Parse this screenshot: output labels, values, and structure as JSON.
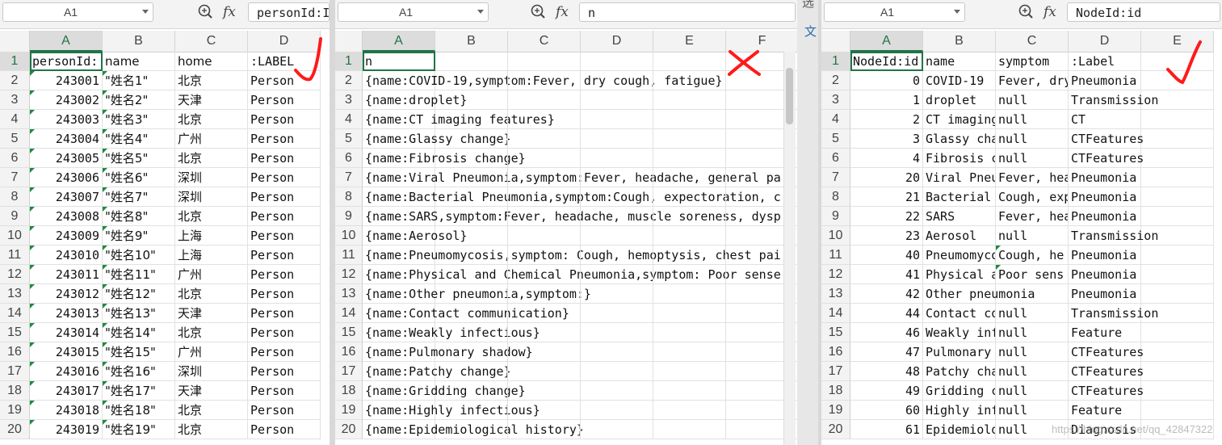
{
  "panes": [
    {
      "namebox": "A1",
      "formula": "personId:I",
      "columns": [
        "A",
        "B",
        "C",
        "D"
      ],
      "rows": [
        [
          "1",
          "personId:",
          "name",
          "home",
          ":LABEL"
        ],
        [
          "2",
          "243001",
          "\"姓名1\"",
          "北京",
          "Person"
        ],
        [
          "3",
          "243002",
          "\"姓名2\"",
          "天津",
          "Person"
        ],
        [
          "4",
          "243003",
          "\"姓名3\"",
          "北京",
          "Person"
        ],
        [
          "5",
          "243004",
          "\"姓名4\"",
          "广州",
          "Person"
        ],
        [
          "6",
          "243005",
          "\"姓名5\"",
          "北京",
          "Person"
        ],
        [
          "7",
          "243006",
          "\"姓名6\"",
          "深圳",
          "Person"
        ],
        [
          "8",
          "243007",
          "\"姓名7\"",
          "深圳",
          "Person"
        ],
        [
          "9",
          "243008",
          "\"姓名8\"",
          "北京",
          "Person"
        ],
        [
          "10",
          "243009",
          "\"姓名9\"",
          "上海",
          "Person"
        ],
        [
          "11",
          "243010",
          "\"姓名10\"",
          "上海",
          "Person"
        ],
        [
          "12",
          "243011",
          "\"姓名11\"",
          "广州",
          "Person"
        ],
        [
          "13",
          "243012",
          "\"姓名12\"",
          "北京",
          "Person"
        ],
        [
          "14",
          "243013",
          "\"姓名13\"",
          "天津",
          "Person"
        ],
        [
          "15",
          "243014",
          "\"姓名14\"",
          "北京",
          "Person"
        ],
        [
          "16",
          "243015",
          "\"姓名15\"",
          "广州",
          "Person"
        ],
        [
          "17",
          "243016",
          "\"姓名16\"",
          "深圳",
          "Person"
        ],
        [
          "18",
          "243017",
          "\"姓名17\"",
          "天津",
          "Person"
        ],
        [
          "19",
          "243018",
          "\"姓名18\"",
          "北京",
          "Person"
        ],
        [
          "20",
          "243019",
          "\"姓名19\"",
          "北京",
          "Person"
        ]
      ]
    },
    {
      "namebox": "A1",
      "formula": "n",
      "columns": [
        "A",
        "B",
        "C",
        "D",
        "E",
        "F"
      ],
      "rows": [
        [
          "1",
          "n"
        ],
        [
          "2",
          "{name:COVID-19,symptom:Fever, dry cough, fatigue}"
        ],
        [
          "3",
          "{name:droplet}"
        ],
        [
          "4",
          "{name:CT imaging features}"
        ],
        [
          "5",
          "{name:Glassy change}"
        ],
        [
          "6",
          "{name:Fibrosis change}"
        ],
        [
          "7",
          "{name:Viral Pneumonia,symptom:Fever, headache, general pa"
        ],
        [
          "8",
          "{name:Bacterial Pneumonia,symptom:Cough, expectoration, c"
        ],
        [
          "9",
          "{name:SARS,symptom:Fever, headache, muscle soreness, dysp"
        ],
        [
          "10",
          "{name:Aerosol}"
        ],
        [
          "11",
          "{name:Pneumomycosis,symptom: Cough, hemoptysis, chest pai"
        ],
        [
          "12",
          "{name:Physical and Chemical Pneumonia,symptom: Poor sense"
        ],
        [
          "13",
          "{name:Other pneumonia,symptom:}"
        ],
        [
          "14",
          "{name:Contact communication}"
        ],
        [
          "15",
          "{name:Weakly infectious}"
        ],
        [
          "16",
          "{name:Pulmonary shadow}"
        ],
        [
          "17",
          "{name:Patchy change}"
        ],
        [
          "18",
          "{name:Gridding change}"
        ],
        [
          "19",
          "{name:Highly infectious}"
        ],
        [
          "20",
          "{name:Epidemiological history}"
        ]
      ]
    },
    {
      "namebox": "A1",
      "formula": "NodeId:id",
      "columns": [
        "A",
        "B",
        "C",
        "D",
        "E"
      ],
      "rows": [
        [
          "1",
          "NodeId:id",
          "name",
          "symptom",
          ":Label"
        ],
        [
          "2",
          "0",
          "COVID-19",
          "Fever, dry",
          "Pneumonia"
        ],
        [
          "3",
          "1",
          "droplet",
          "null",
          "Transmission"
        ],
        [
          "4",
          "2",
          "CT imaging",
          "null",
          "CT"
        ],
        [
          "5",
          "3",
          "Glassy cha",
          "null",
          "CTFeatures"
        ],
        [
          "6",
          "4",
          "Fibrosis c",
          "null",
          "CTFeatures"
        ],
        [
          "7",
          "20",
          "Viral Pneu",
          "Fever, hea",
          "Pneumonia"
        ],
        [
          "8",
          "21",
          "Bacterial",
          "Cough, exp",
          "Pneumonia"
        ],
        [
          "9",
          "22",
          "SARS",
          "Fever, hea",
          "Pneumonia"
        ],
        [
          "10",
          "23",
          "Aerosol",
          "null",
          "Transmission"
        ],
        [
          "11",
          "40",
          "Pneumomyco",
          "Cough, he",
          "Pneumonia"
        ],
        [
          "12",
          "41",
          "Physical a",
          "Poor sens",
          "Pneumonia"
        ],
        [
          "13",
          "42",
          "Other pneumonia",
          "",
          "Pneumonia"
        ],
        [
          "14",
          "44",
          "Contact co",
          "null",
          "Transmission"
        ],
        [
          "15",
          "46",
          "Weakly inf",
          "null",
          "Feature"
        ],
        [
          "16",
          "47",
          "Pulmonary",
          "null",
          "CTFeatures"
        ],
        [
          "17",
          "48",
          "Patchy cha",
          "null",
          "CTFeatures"
        ],
        [
          "18",
          "49",
          "Gridding c",
          "null",
          "CTFeatures"
        ],
        [
          "19",
          "60",
          "Highly inf",
          "null",
          "Feature"
        ],
        [
          "20",
          "61",
          "Epidemiolo",
          "null",
          "Diagnosis"
        ]
      ]
    }
  ],
  "overflow_glyphs": [
    "选",
    "文"
  ],
  "watermark": "https://blog.csdn.net/qq_42847322",
  "annotations": [
    "check-mark",
    "cross-mark",
    "check-mark"
  ],
  "colors": {
    "accent": "#217346",
    "mark": "#ff1a1a"
  }
}
